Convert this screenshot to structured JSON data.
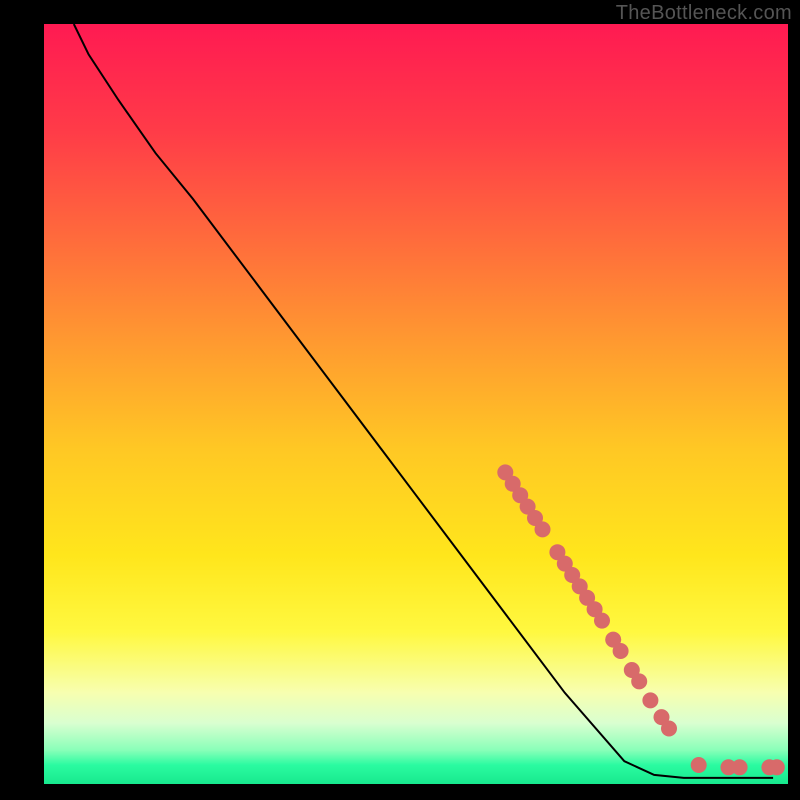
{
  "watermark": "TheBottleneck.com",
  "chart_data": {
    "type": "line",
    "title": "",
    "xlabel": "",
    "ylabel": "",
    "xlim": [
      0,
      100
    ],
    "ylim": [
      0,
      100
    ],
    "grid": false,
    "legend": false,
    "gradient_stops": [
      {
        "pct": 0.0,
        "color": "#ff1a52"
      },
      {
        "pct": 0.14,
        "color": "#ff3b48"
      },
      {
        "pct": 0.28,
        "color": "#ff6a3c"
      },
      {
        "pct": 0.42,
        "color": "#ff9a30"
      },
      {
        "pct": 0.56,
        "color": "#ffc824"
      },
      {
        "pct": 0.7,
        "color": "#ffe61c"
      },
      {
        "pct": 0.8,
        "color": "#fff840"
      },
      {
        "pct": 0.88,
        "color": "#f7ffb0"
      },
      {
        "pct": 0.92,
        "color": "#d9ffd0"
      },
      {
        "pct": 0.955,
        "color": "#8affb9"
      },
      {
        "pct": 0.975,
        "color": "#2bfba1"
      },
      {
        "pct": 1.0,
        "color": "#17e98e"
      }
    ],
    "series": [
      {
        "name": "curve",
        "stroke": "#000000",
        "points": [
          {
            "x": 4,
            "y": 100
          },
          {
            "x": 6,
            "y": 96
          },
          {
            "x": 10,
            "y": 90
          },
          {
            "x": 15,
            "y": 83
          },
          {
            "x": 20,
            "y": 77
          },
          {
            "x": 30,
            "y": 64
          },
          {
            "x": 40,
            "y": 51
          },
          {
            "x": 50,
            "y": 38
          },
          {
            "x": 60,
            "y": 25
          },
          {
            "x": 70,
            "y": 12
          },
          {
            "x": 78,
            "y": 3
          },
          {
            "x": 82,
            "y": 1.2
          },
          {
            "x": 86,
            "y": 0.8
          },
          {
            "x": 92,
            "y": 0.8
          },
          {
            "x": 98,
            "y": 0.8
          }
        ]
      }
    ],
    "markers": {
      "color": "#d86a6a",
      "radius_px": 8,
      "points": [
        {
          "x": 62,
          "y": 41
        },
        {
          "x": 63,
          "y": 39.5
        },
        {
          "x": 64,
          "y": 38
        },
        {
          "x": 65,
          "y": 36.5
        },
        {
          "x": 66,
          "y": 35
        },
        {
          "x": 67,
          "y": 33.5
        },
        {
          "x": 69,
          "y": 30.5
        },
        {
          "x": 70,
          "y": 29
        },
        {
          "x": 71,
          "y": 27.5
        },
        {
          "x": 72,
          "y": 26
        },
        {
          "x": 73,
          "y": 24.5
        },
        {
          "x": 74,
          "y": 23
        },
        {
          "x": 75,
          "y": 21.5
        },
        {
          "x": 76.5,
          "y": 19
        },
        {
          "x": 77.5,
          "y": 17.5
        },
        {
          "x": 79,
          "y": 15
        },
        {
          "x": 80,
          "y": 13.5
        },
        {
          "x": 81.5,
          "y": 11
        },
        {
          "x": 83,
          "y": 8.8
        },
        {
          "x": 84,
          "y": 7.3
        },
        {
          "x": 88,
          "y": 2.5
        },
        {
          "x": 92,
          "y": 2.2
        },
        {
          "x": 93.5,
          "y": 2.2
        },
        {
          "x": 97.5,
          "y": 2.2
        },
        {
          "x": 98.5,
          "y": 2.2
        }
      ]
    }
  }
}
